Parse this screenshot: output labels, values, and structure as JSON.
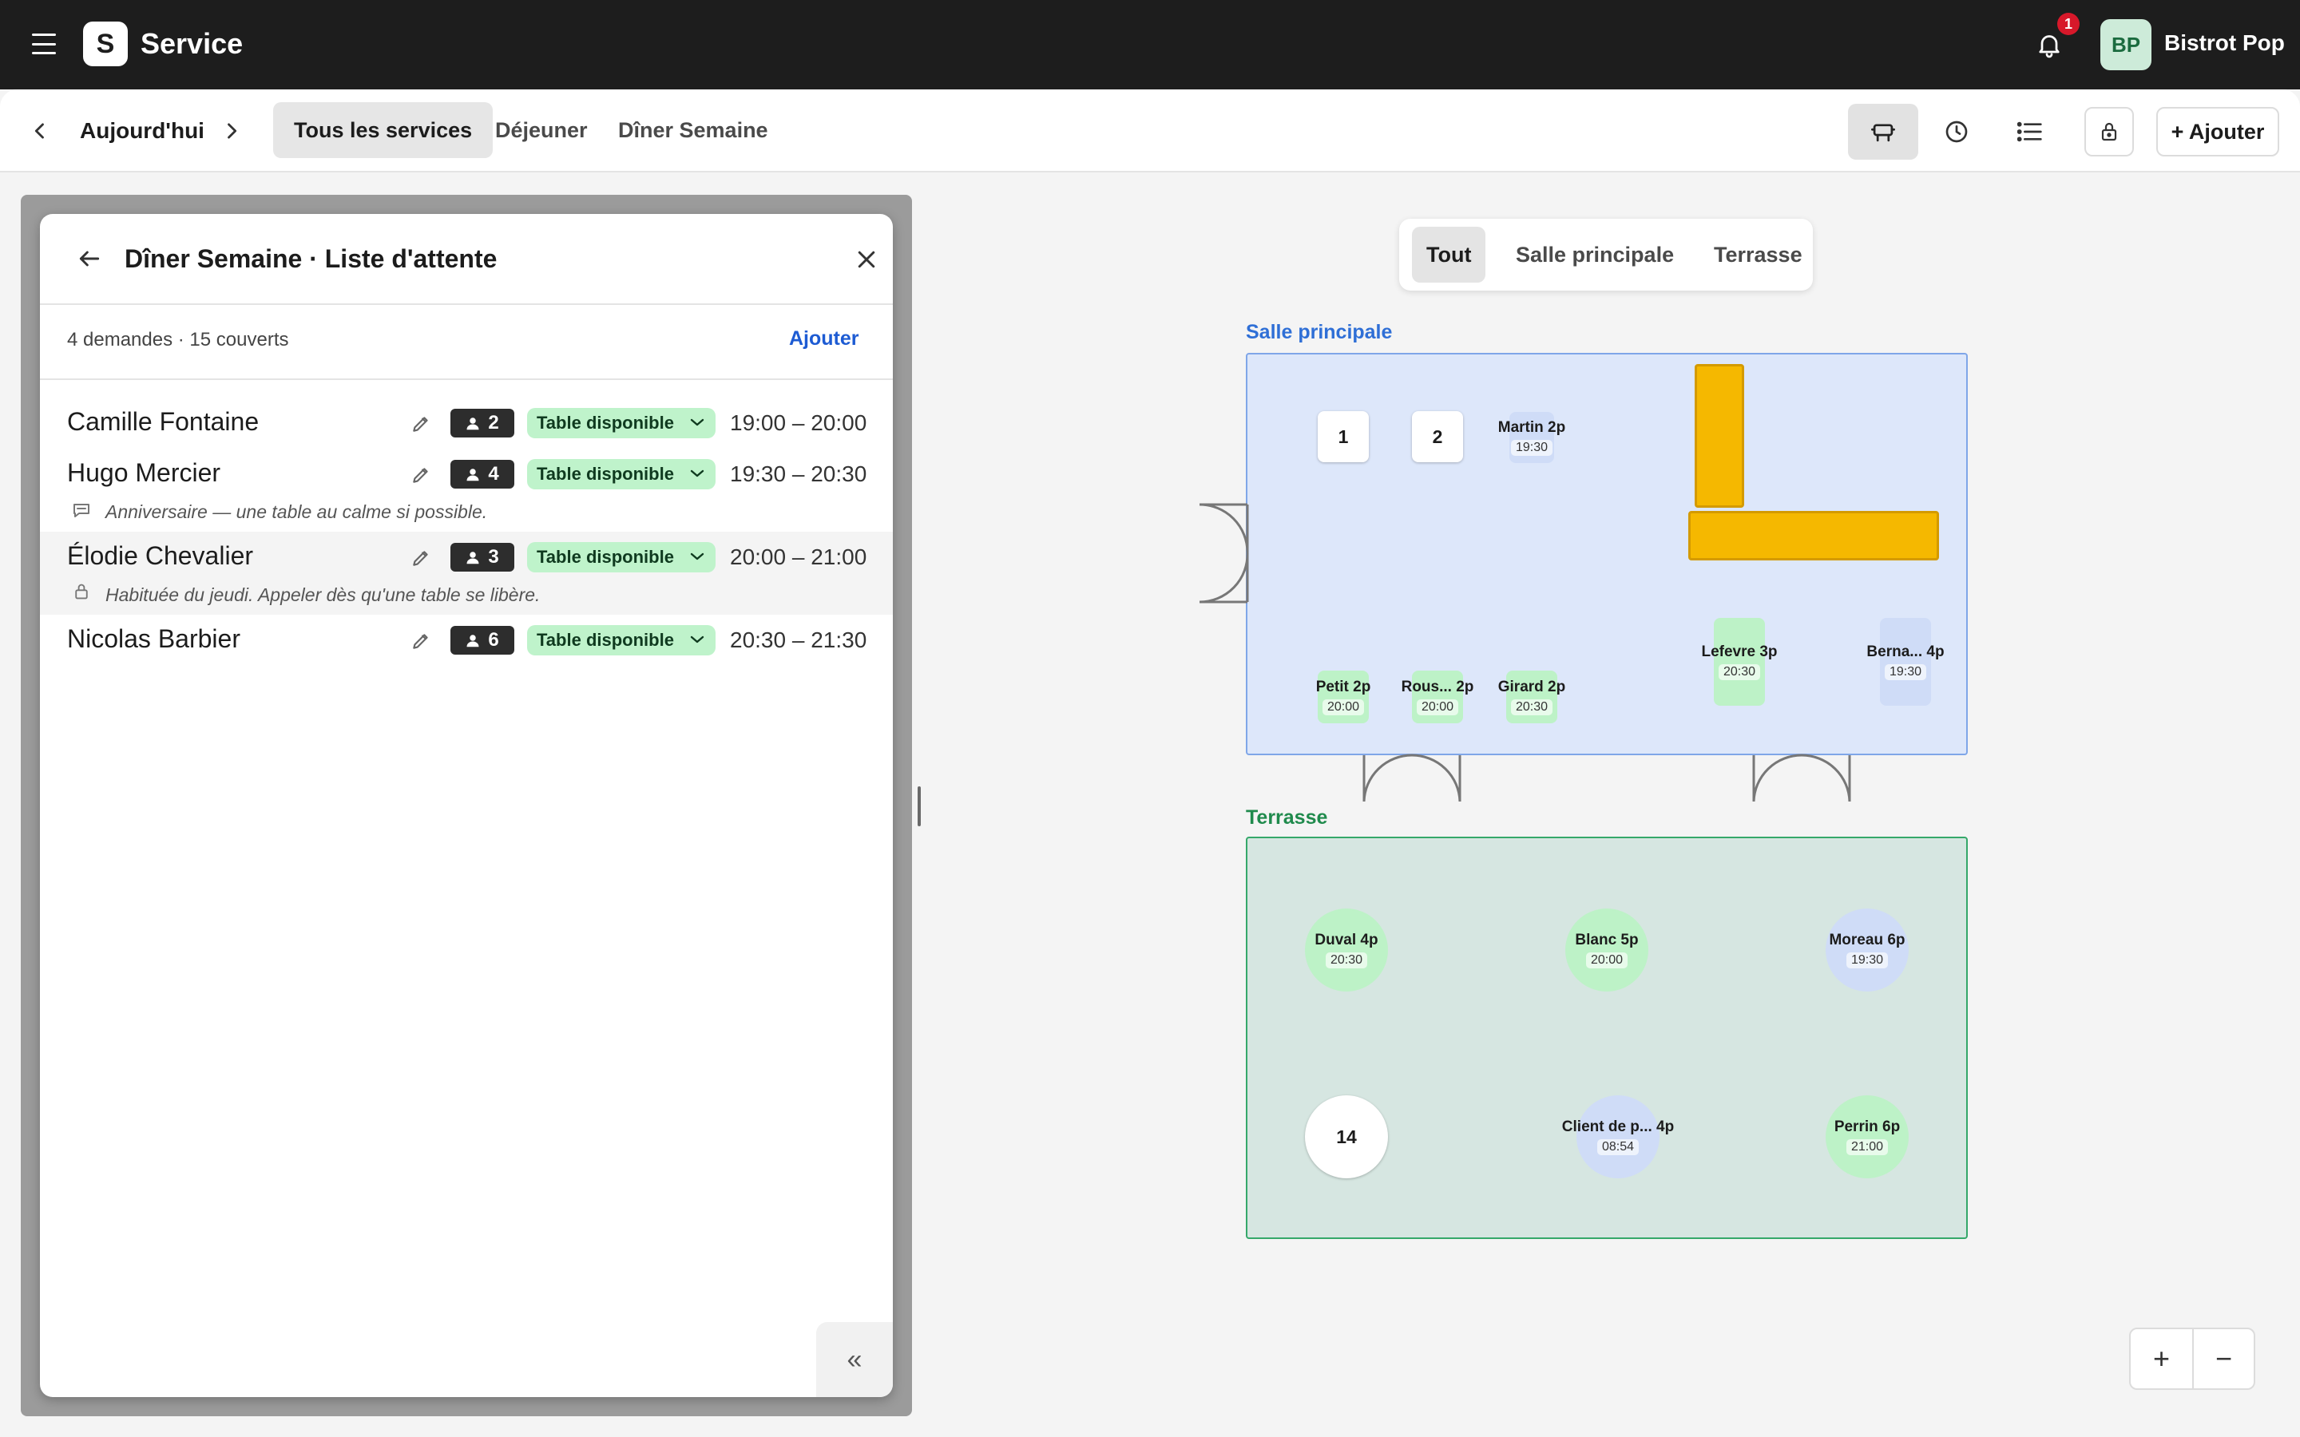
{
  "app": {
    "logo_letter": "S",
    "title": "Service",
    "notification_count": "1",
    "avatar_initials": "BP",
    "account_name": "Bistrot Pop"
  },
  "date_nav": {
    "label": "Aujourd'hui"
  },
  "service_tabs": [
    {
      "label": "Tous les services",
      "active": true
    },
    {
      "label": "Déjeuner",
      "active": false
    },
    {
      "label": "Dîner Semaine",
      "active": false
    }
  ],
  "toolbar": {
    "add_label": "+ Ajouter"
  },
  "panel": {
    "title": "Dîner Semaine · Liste d'attente",
    "summary": "4 demandes · 15 couverts",
    "add_label": "Ajouter",
    "rows": [
      {
        "name": "Camille Fontaine",
        "party": "2",
        "status": "Table disponible",
        "time": "19:00 – 20:00",
        "note": ""
      },
      {
        "name": "Hugo Mercier",
        "party": "4",
        "status": "Table disponible",
        "time": "19:30 – 20:30",
        "note": "Anniversaire — une table au calme si possible."
      },
      {
        "name": "Élodie Chevalier",
        "party": "3",
        "status": "Table disponible",
        "time": "20:00 – 21:00",
        "note": "Habituée du jeudi. Appeler dès qu'une table se libère."
      },
      {
        "name": "Nicolas Barbier",
        "party": "6",
        "status": "Table disponible",
        "time": "20:30 – 21:30",
        "note": ""
      }
    ],
    "collapse_glyph": "«"
  },
  "floor_tabs": [
    {
      "label": "Tout",
      "active": true
    },
    {
      "label": "Salle principale",
      "active": false
    },
    {
      "label": "Terrasse",
      "active": false
    }
  ],
  "zones": {
    "salle": {
      "label": "Salle principale",
      "color": "#2f6fd6",
      "tables": [
        {
          "label": "1",
          "time": "",
          "status": "free"
        },
        {
          "label": "2",
          "time": "",
          "status": "free"
        },
        {
          "label": "Martin 2p",
          "time": "19:30",
          "status": "booked"
        },
        {
          "label": "Lefevre 3p",
          "time": "20:30",
          "status": "seated"
        },
        {
          "label": "Berna... 4p",
          "time": "19:30",
          "status": "booked"
        },
        {
          "label": "Petit 2p",
          "time": "20:00",
          "status": "seated"
        },
        {
          "label": "Rous... 2p",
          "time": "20:00",
          "status": "seated"
        },
        {
          "label": "Girard 2p",
          "time": "20:30",
          "status": "seated"
        }
      ]
    },
    "terrasse": {
      "label": "Terrasse",
      "color": "#1f8a4c",
      "tables": [
        {
          "label": "Duval 4p",
          "time": "20:30",
          "status": "seated"
        },
        {
          "label": "Blanc 5p",
          "time": "20:00",
          "status": "seated"
        },
        {
          "label": "Moreau 6p",
          "time": "19:30",
          "status": "booked"
        },
        {
          "label": "14",
          "time": "",
          "status": "free"
        },
        {
          "label": "Client de p... 4p",
          "time": "08:54",
          "status": "booked"
        },
        {
          "label": "Perrin 6p",
          "time": "21:00",
          "status": "seated"
        }
      ]
    }
  },
  "zoom": {
    "in": "+",
    "out": "−"
  },
  "colors": {
    "topbar": "#1d1d1d",
    "status_pill": "#bff3cb",
    "bar_counter": "#f5b800",
    "salle_bg": "#dde7fa",
    "terrasse_bg": "#d6e6e1"
  }
}
